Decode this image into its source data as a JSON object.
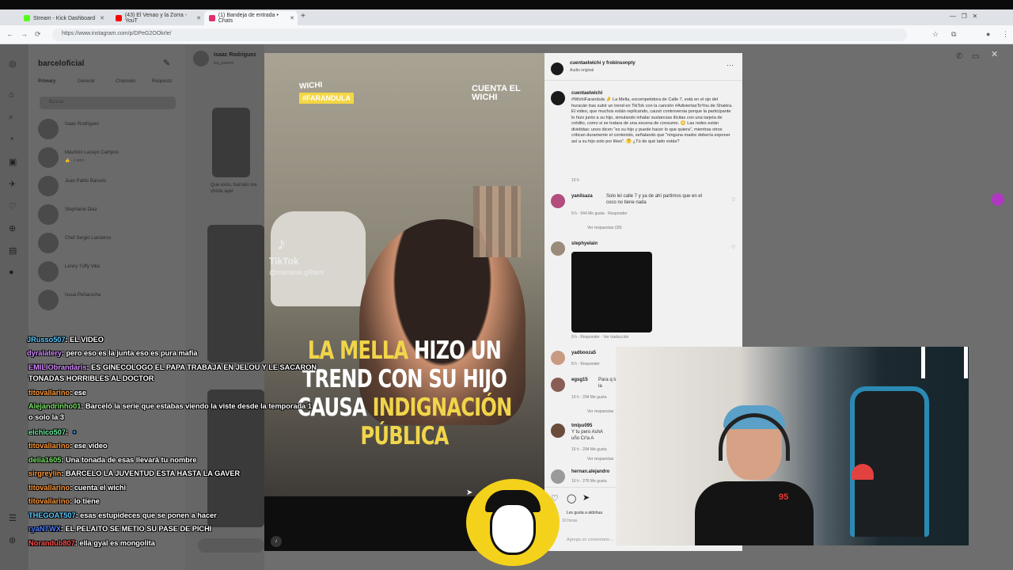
{
  "browser": {
    "tabs": [
      {
        "label": "Stream - Kick Dashboard",
        "color": "#53fc18"
      },
      {
        "label": "(43) El Venao y la Zorra - YouT",
        "color": "#ff0000"
      },
      {
        "label": "(1) Bandeja de entrada • Chats",
        "color": "#e1306c"
      }
    ],
    "new_tab": "+",
    "url": "https://www.instagram.com/p/DPeG2OOkrle/"
  },
  "instagram": {
    "account": "barceloficial",
    "inbox_tabs": [
      "Primary",
      "General",
      "Channels",
      "Requests"
    ],
    "search_placeholder": "Buscar",
    "conversations": [
      {
        "name": "Isaac Rodriguez",
        "sub": ""
      },
      {
        "name": "Mauricio Lacayo Campos",
        "sub": "👍 · 1 sem"
      },
      {
        "name": "Juan Pablo Barcelo",
        "sub": ""
      },
      {
        "name": "Stephanie Diaz",
        "sub": ""
      },
      {
        "name": "Chef Sergio Landeros",
        "sub": ""
      },
      {
        "name": "Lenny Tuffy Villa",
        "sub": ""
      },
      {
        "name": "Issua Peñarocha",
        "sub": ""
      }
    ],
    "chat_header": {
      "name": "Isaac Rodriguez",
      "sub": "ica_parerrn"
    },
    "chat_snippet": "Que esos, barcelo me chiste ayer"
  },
  "video": {
    "tag_top": "WICHI",
    "tag_yellow": "#FARANDULA",
    "cuenta": "CUENTA EL WICHI",
    "tiktok": "TikTok",
    "tiktok_handle": "@marlene.gilbert",
    "headline_1a": "LA MELLA",
    "headline_1b": " HIZO UN",
    "headline_2": "TREND CON SU HIJO",
    "headline_3a": "CAUSA ",
    "headline_3b": "INDIGNACIÓN",
    "headline_4": "PÚBLICA"
  },
  "post": {
    "header_user": "cuentaelwichi y frobinsonpty",
    "header_audio": "Audio original",
    "caption_user": "cuentaelwichi",
    "caption": "#WichiFarandula 🤌 La Mella, excompetidora de Calle 7, está en el ojo del huracán tras subir un trend en TikTok con la canción #AdiviertasToYou de Shakira. El video, que muchos están replicando, causó controversia porque la participante lo hizo junto a su hijo, simulando inhalar sustancias ilícitas con una tarjeta de crédito, como si se tratara de una escena de consumo. 😳 Las redes están divididas: unos dicen \"es su hijo y puede hacer lo que quiera\", mientras otros critican duramente el contenido, señalando que \"ninguna madre debería exponer así a su hijo solo por likes\". 🤔 ¿Tú de qué lado estás?",
    "caption_time": "10 h",
    "comments": [
      {
        "user": "yanilsaza",
        "text": "Solo leí calle 7 y ya de ahí partimos que en el coco no tiene nada",
        "meta": "9 h · 544 Me gusta · Responder",
        "replies": "Ver respuestas (39)"
      },
      {
        "user": "stephyelain",
        "text": "",
        "meta": "9 h · Responder · Ver traducción",
        "replies": ""
      },
      {
        "user": "yadbooza5",
        "text": "😂😂😂",
        "meta": "8 h · Responder",
        "replies": ""
      },
      {
        "user": "egsg15",
        "text": "Para q la la",
        "meta": "10 h · 294 Me gusta",
        "replies": "Ver respuestas"
      },
      {
        "user": "tmlpu095",
        "text": "Y tu pero AshA uño Cr!a A",
        "meta": "10 h · 294 Me gusta",
        "replies": "Ver respuestas"
      },
      {
        "user": "hernan.alejandro",
        "text": "",
        "meta": "10 h · 276 Me gusta",
        "replies": ""
      }
    ],
    "likes": "Les gusta a aldohua",
    "likes_time": "10 horas",
    "comment_placeholder": "Agrega un comentario..."
  },
  "chat": {
    "messages": [
      {
        "user": "JRusso507",
        "color": "#5ec8ff",
        "text": ": EL VIDEO"
      },
      {
        "user": "dyralatery",
        "color": "#d58cff",
        "text": ": pero eso es la junta eso es pura mafia"
      },
      {
        "user": "EMILIObrandaris",
        "color": "#d58cff",
        "text": ": ES GINECOLOGO EL PAPA TRABAJA EN JELOU Y LE SACARON TONADAS HORRIBLES AL DOCTOR"
      },
      {
        "user": "titovallarino",
        "color": "#ff9a3c",
        "text": ": ese"
      },
      {
        "user": "Alejandrinho01",
        "color": "#7de36b",
        "text": ": Barceló la serie que estabas viendo la viste desde la temporada 1 o solo la 3"
      },
      {
        "user": "elchico507",
        "color": "#6ef0a0",
        "text": ": 🔹"
      },
      {
        "user": "titovallarino",
        "color": "#ff9a3c",
        "text": ": ese video"
      },
      {
        "user": "delia1605",
        "color": "#7de36b",
        "text": ": Una tonada de esas llevará tu nombre"
      },
      {
        "user": "sirgreylin",
        "color": "#ff9a3c",
        "text": ": BARCELO LA JUVENTUD ESTA HASTA LA GAVER"
      },
      {
        "user": "titovallarino",
        "color": "#ff9a3c",
        "text": ": cuenta el wichi"
      },
      {
        "user": "titovallarino",
        "color": "#ff9a3c",
        "text": ": lo tiene"
      },
      {
        "user": "THEGOAT507",
        "color": "#5ec8ff",
        "text": ": esas estupideces que se ponen a hacer"
      },
      {
        "user": "ryaNTWX",
        "color": "#4f7dff",
        "text": ": EL PELAITO SE METIO SU PASE DE PICHI"
      },
      {
        "user": "Norandub807",
        "color": "#ff4d4d",
        "text": ": ella gyal es mongolita"
      }
    ]
  },
  "webcam": {
    "number": "95"
  }
}
